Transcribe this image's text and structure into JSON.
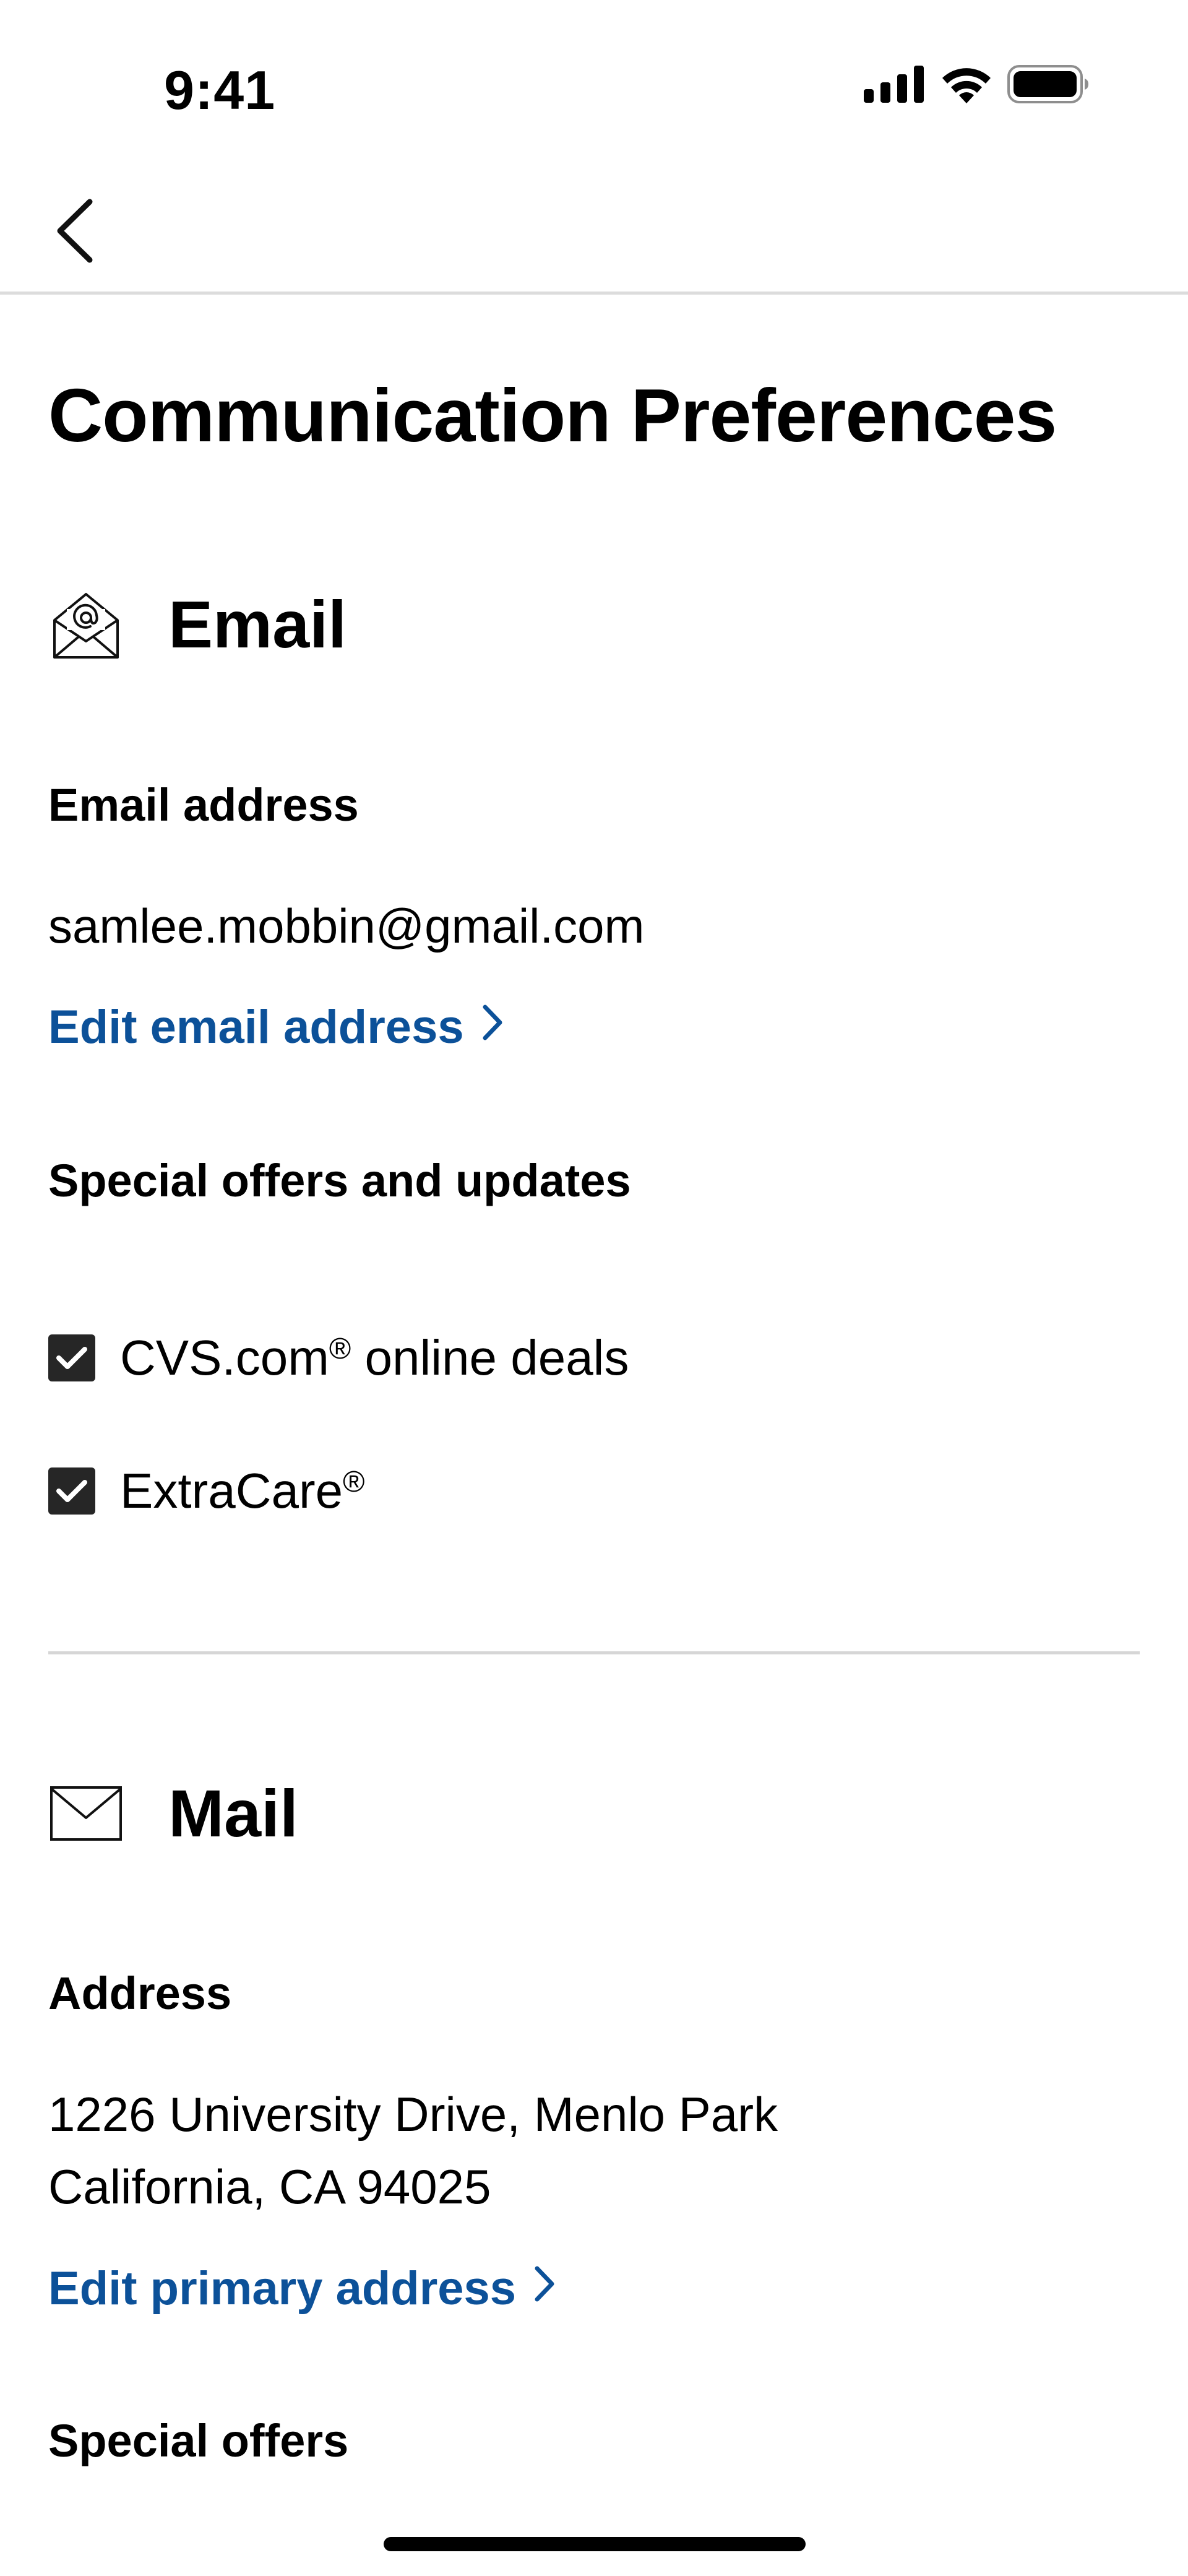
{
  "status_bar": {
    "time": "9:41",
    "icons": [
      "cellular-signal-icon",
      "wifi-icon",
      "battery-icon"
    ]
  },
  "nav": {
    "back_icon": "chevron-left-icon"
  },
  "page": {
    "title": "Communication Preferences"
  },
  "email_section": {
    "icon": "envelope-open-at-icon",
    "title": "Email",
    "address_label": "Email address",
    "address_value": "samlee.mobbin@gmail.com",
    "edit_link": "Edit email address",
    "offers_label": "Special offers and updates",
    "options": [
      {
        "label": "CVS.com",
        "suffix": "®",
        "rest": " online deals",
        "checked": true
      },
      {
        "label": "ExtraCare",
        "suffix": "®",
        "rest": "",
        "checked": true
      }
    ]
  },
  "mail_section": {
    "icon": "envelope-icon",
    "title": "Mail",
    "address_label": "Address",
    "address_line1": "1226 University Drive, Menlo Park",
    "address_line2": "California, CA 94025",
    "edit_link": "Edit primary address",
    "offers_label": "Special offers"
  },
  "colors": {
    "link": "#0c5199",
    "checkbox": "#262626",
    "divider": "#d6d6d6"
  }
}
